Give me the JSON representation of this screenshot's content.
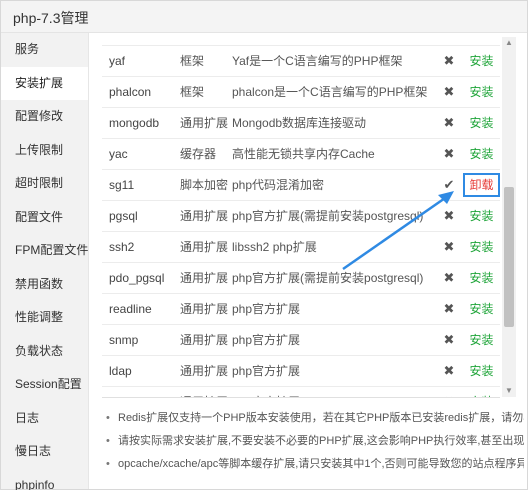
{
  "window": {
    "title": "php-7.3管理"
  },
  "sidebar": {
    "items": [
      {
        "label": "服务",
        "active": false
      },
      {
        "label": "安装扩展",
        "active": true
      },
      {
        "label": "配置修改",
        "active": false
      },
      {
        "label": "上传限制",
        "active": false
      },
      {
        "label": "超时限制",
        "active": false
      },
      {
        "label": "配置文件",
        "active": false
      },
      {
        "label": "FPM配置文件",
        "active": false
      },
      {
        "label": "禁用函数",
        "active": false
      },
      {
        "label": "性能调整",
        "active": false
      },
      {
        "label": "负载状态",
        "active": false
      },
      {
        "label": "Session配置",
        "active": false
      },
      {
        "label": "日志",
        "active": false
      },
      {
        "label": "慢日志",
        "active": false
      },
      {
        "label": "phpinfo",
        "active": false
      }
    ]
  },
  "extensions": {
    "rows": [
      {
        "name": "yaf",
        "type": "框架",
        "desc": "Yaf是一个C语言编写的PHP框架",
        "status": "✖",
        "action": "安装",
        "installed": false
      },
      {
        "name": "phalcon",
        "type": "框架",
        "desc": "phalcon是一个C语言编写的PHP框架",
        "status": "✖",
        "action": "安装",
        "installed": false
      },
      {
        "name": "mongodb",
        "type": "通用扩展",
        "desc": "Mongodb数据库连接驱动",
        "status": "✖",
        "action": "安装",
        "installed": false
      },
      {
        "name": "yac",
        "type": "缓存器",
        "desc": "高性能无锁共享内存Cache",
        "status": "✖",
        "action": "安装",
        "installed": false
      },
      {
        "name": "sg11",
        "type": "脚本加密",
        "desc": "php代码混淆加密",
        "status": "✔",
        "action": "卸载",
        "installed": true
      },
      {
        "name": "pgsql",
        "type": "通用扩展",
        "desc": "php官方扩展(需提前安装postgresql)",
        "status": "✖",
        "action": "安装",
        "installed": false
      },
      {
        "name": "ssh2",
        "type": "通用扩展",
        "desc": "libssh2 php扩展",
        "status": "✖",
        "action": "安装",
        "installed": false
      },
      {
        "name": "pdo_pgsql",
        "type": "通用扩展",
        "desc": "php官方扩展(需提前安装postgresql)",
        "status": "✖",
        "action": "安装",
        "installed": false
      },
      {
        "name": "readline",
        "type": "通用扩展",
        "desc": "php官方扩展",
        "status": "✖",
        "action": "安装",
        "installed": false
      },
      {
        "name": "snmp",
        "type": "通用扩展",
        "desc": "php官方扩展",
        "status": "✖",
        "action": "安装",
        "installed": false
      },
      {
        "name": "ldap",
        "type": "通用扩展",
        "desc": "php官方扩展",
        "status": "✖",
        "action": "安装",
        "installed": false
      },
      {
        "name": "recode",
        "type": "通用扩展",
        "desc": "php官方扩展",
        "status": "✖",
        "action": "安装",
        "installed": false
      }
    ]
  },
  "notes": [
    "Redis扩展仅支持一个PHP版本安装使用，若在其它PHP版本已安装redis扩展，请勿再装",
    "请按实际需求安装扩展,不要安装不必要的PHP扩展,这会影响PHP执行效率,甚至出现异常",
    "opcache/xcache/apc等脚本缓存扩展,请只安装其中1个,否则可能导致您的站点程序异常"
  ],
  "colors": {
    "install": "#20a53a",
    "uninstall": "#e53935",
    "annotation": "#2f8ae3"
  }
}
